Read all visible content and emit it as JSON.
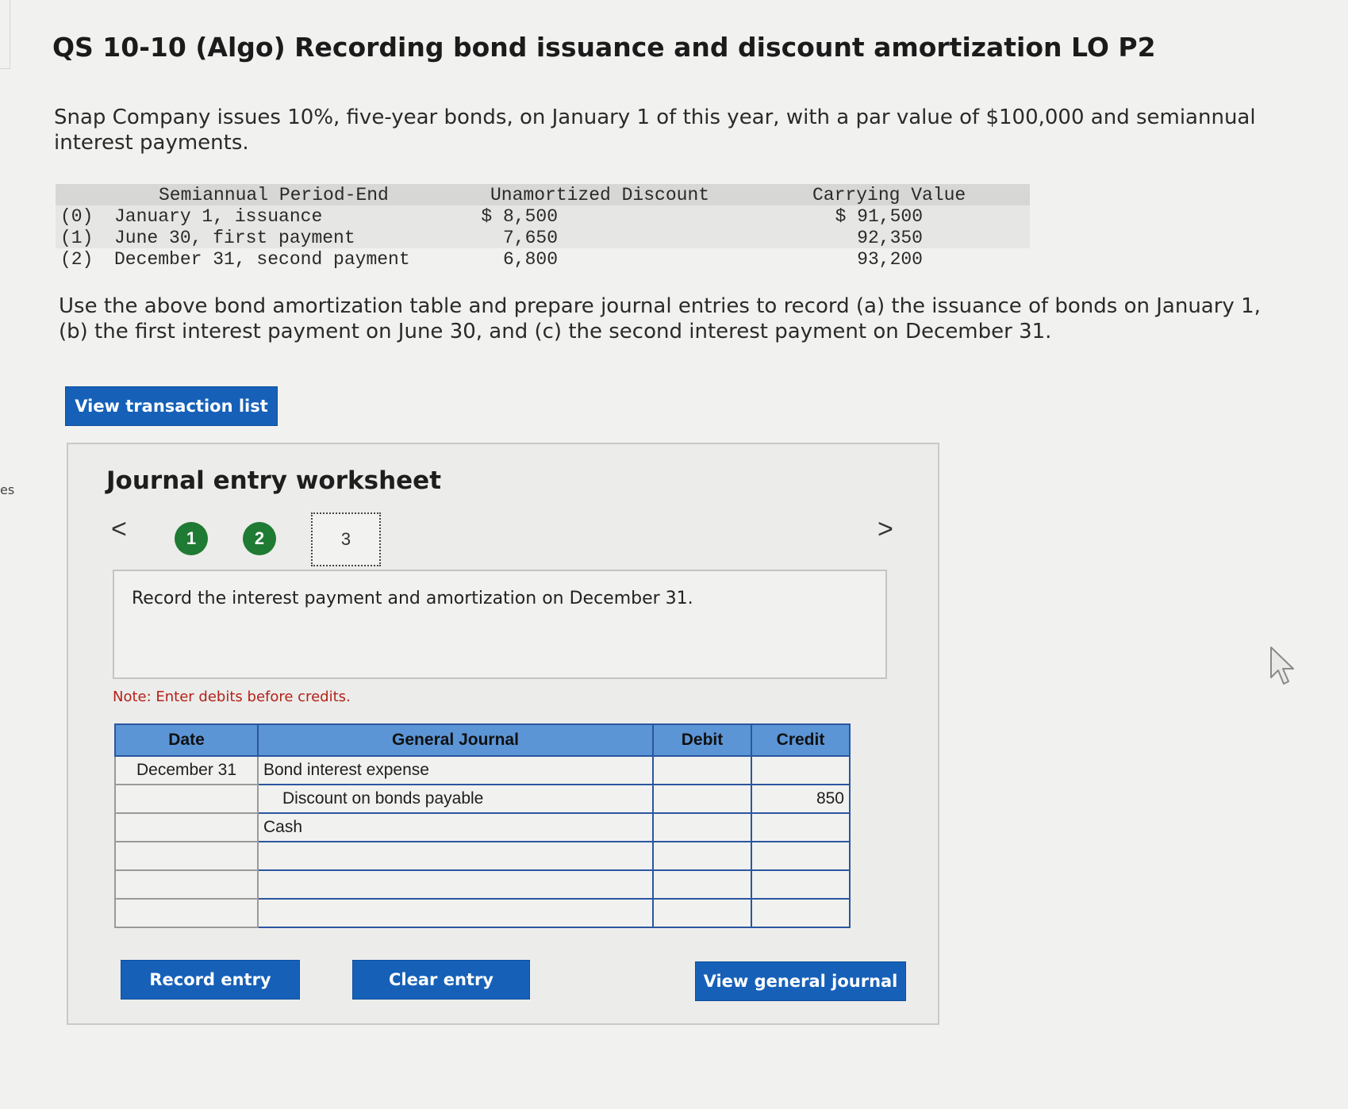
{
  "sidebar": {
    "tab_text": "es"
  },
  "page": {
    "title": "QS 10-10 (Algo) Recording bond issuance and discount amortization LO P2",
    "intro": "Snap Company issues 10%, five-year bonds, on January 1 of this year, with a par value of $100,000 and semiannual interest payments.",
    "instructions": "Use the above bond amortization table and prepare journal entries to record (a) the issuance of bonds on January 1, (b) the first interest payment on June 30, and (c) the second interest payment on December 31."
  },
  "amortization_table": {
    "headers": {
      "period": "Semiannual Period-End",
      "discount": "Unamortized Discount",
      "carrying": "Carrying Value"
    },
    "rows": [
      {
        "index": "(0)",
        "label": "January 1, issuance",
        "discount": "$ 8,500",
        "carrying": "$ 91,500"
      },
      {
        "index": "(1)",
        "label": "June 30, first payment",
        "discount": "7,650",
        "carrying": "92,350"
      },
      {
        "index": "(2)",
        "label": "December 31, second payment",
        "discount": "6,800",
        "carrying": "93,200"
      }
    ]
  },
  "buttons": {
    "view_transaction_list": "View transaction list",
    "record_entry": "Record entry",
    "clear_entry": "Clear entry",
    "view_general_journal": "View general journal"
  },
  "worksheet": {
    "title": "Journal entry worksheet",
    "nav_prev": "<",
    "nav_next": ">",
    "steps": [
      "1",
      "2",
      "3"
    ],
    "prompt": "Record the interest payment and amortization on December 31.",
    "note": "Note: Enter debits before credits."
  },
  "journal": {
    "headers": {
      "date": "Date",
      "general_journal": "General Journal",
      "debit": "Debit",
      "credit": "Credit"
    },
    "rows": [
      {
        "date": "December 31",
        "account": "Bond interest expense",
        "debit": "",
        "credit": ""
      },
      {
        "date": "",
        "account": "Discount on bonds payable",
        "debit": "",
        "credit": "850"
      },
      {
        "date": "",
        "account": "Cash",
        "debit": "",
        "credit": ""
      },
      {
        "date": "",
        "account": "",
        "debit": "",
        "credit": ""
      },
      {
        "date": "",
        "account": "",
        "debit": "",
        "credit": ""
      },
      {
        "date": "",
        "account": "",
        "debit": "",
        "credit": ""
      }
    ]
  },
  "colors": {
    "primary_button": "#1660b8",
    "table_header": "#5b95d6",
    "step_complete": "#1f7a33",
    "note": "#b3221a"
  },
  "icons": {
    "cursor": "mouse-pointer-icon",
    "prev": "chevron-left-icon",
    "next": "chevron-right-icon"
  }
}
